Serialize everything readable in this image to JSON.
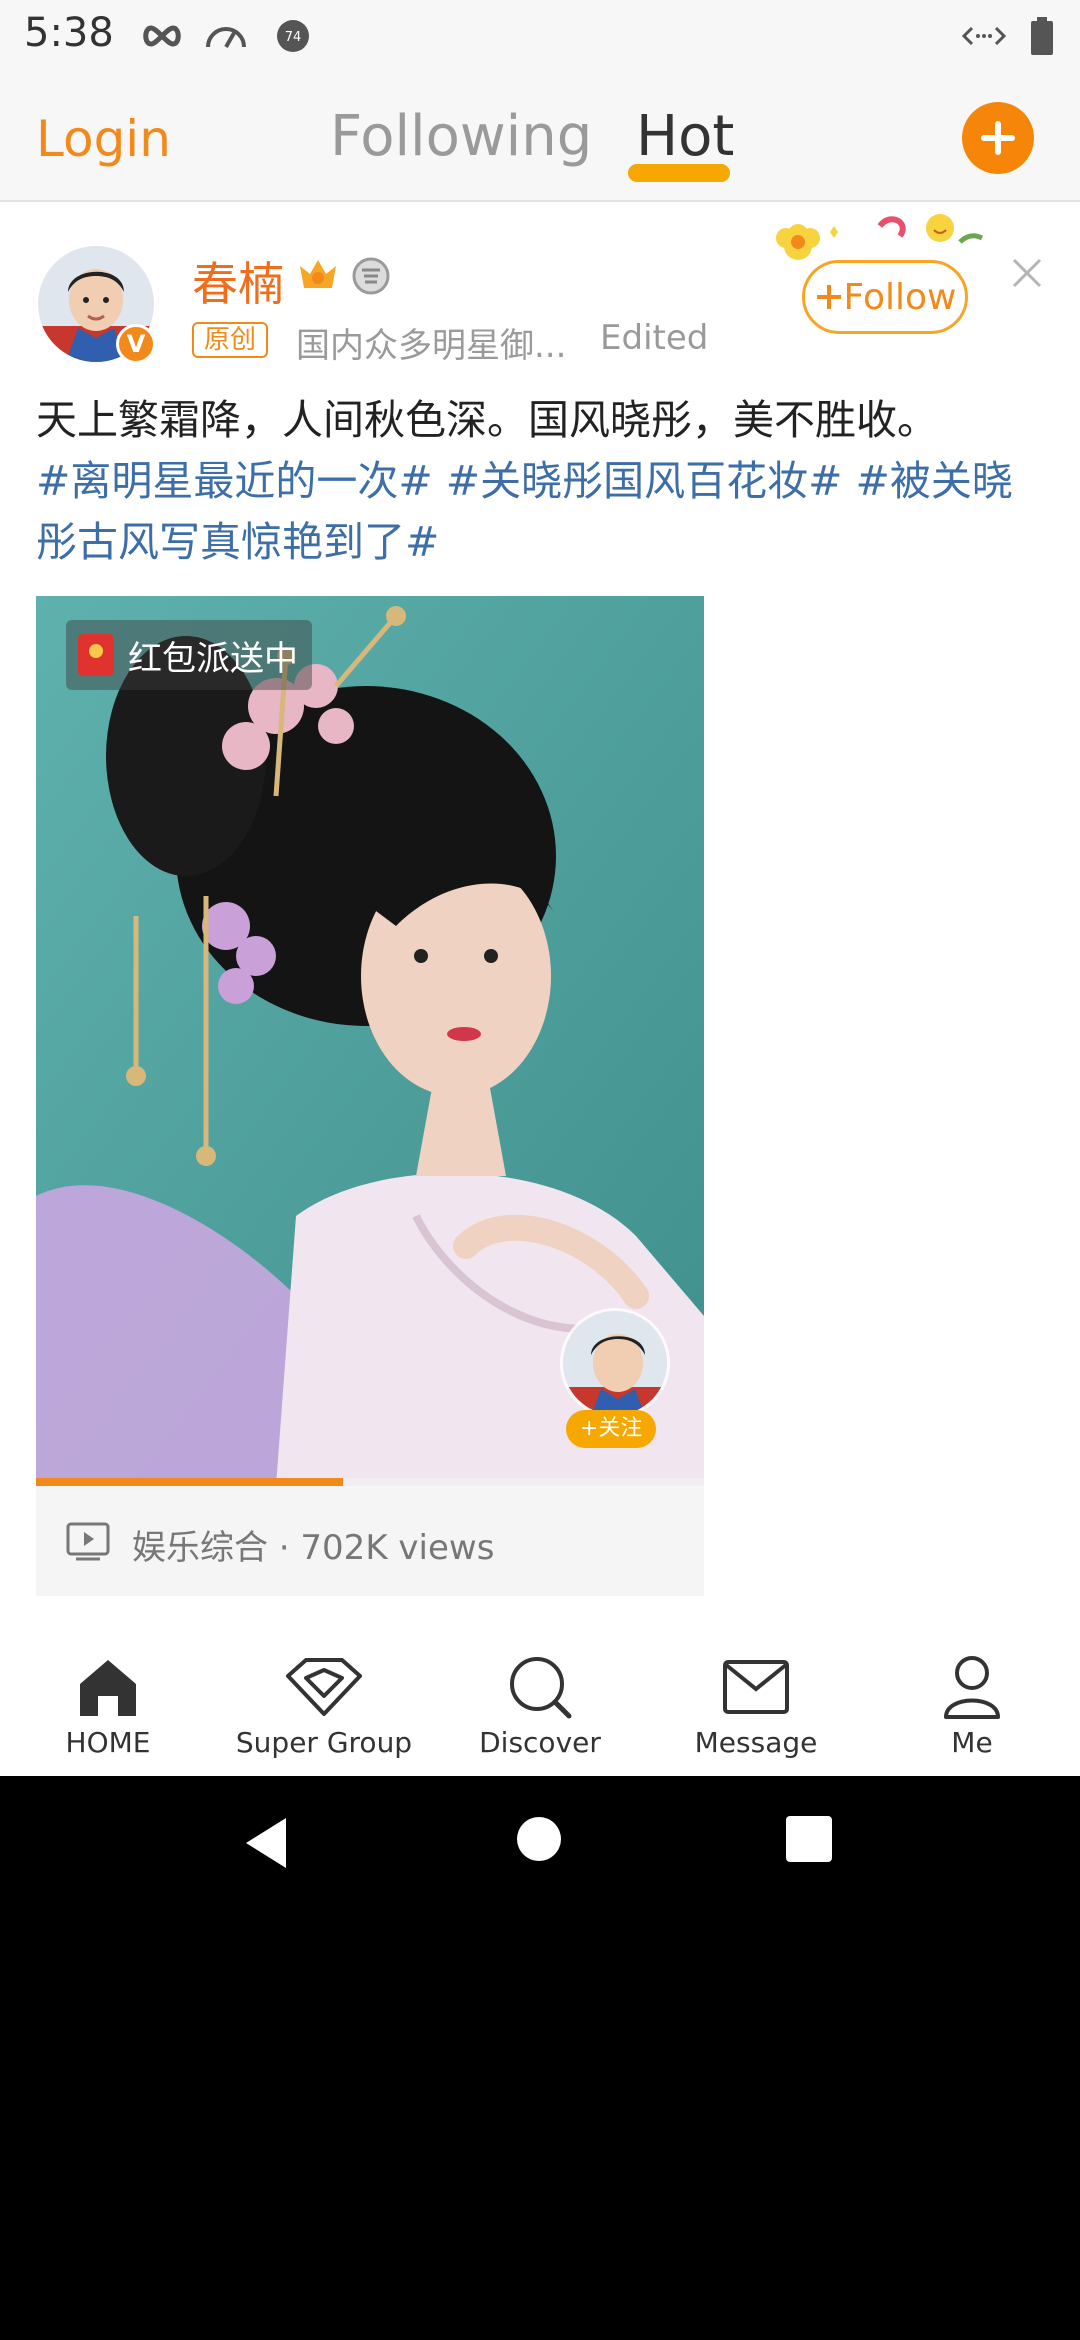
{
  "status_bar": {
    "time": "5:38",
    "notification_count": "74"
  },
  "top_nav": {
    "login_label": "Login",
    "tabs": [
      {
        "label": "Following",
        "active": false
      },
      {
        "label": "Hot",
        "active": true
      }
    ],
    "accent_color": "#f18a1a"
  },
  "post": {
    "username": "春楠",
    "original_tag": "原创",
    "source_text": "国内众多明星御...",
    "edited_label": "Edited",
    "follow_label": "Follow",
    "text": "天上繁霜降，人间秋色深。国风晓彤，美不胜收。",
    "hashtags": [
      "#离明星最近的一次#",
      "#关晓彤国风百花妆#",
      "#被关晓彤古风写真惊艳到了#"
    ],
    "media": {
      "red_packet_label": "红包派送中",
      "mini_follow_label": "+关注",
      "progress": 0.46,
      "category_views": "娱乐综合 · 702K views"
    }
  },
  "bottom_nav": {
    "items": [
      {
        "label": "HOME",
        "icon": "home-icon",
        "active": true
      },
      {
        "label": "Super Group",
        "icon": "diamond-icon",
        "active": false
      },
      {
        "label": "Discover",
        "icon": "search-icon",
        "active": false
      },
      {
        "label": "Message",
        "icon": "mail-icon",
        "active": false
      },
      {
        "label": "Me",
        "icon": "person-icon",
        "active": false
      }
    ]
  }
}
